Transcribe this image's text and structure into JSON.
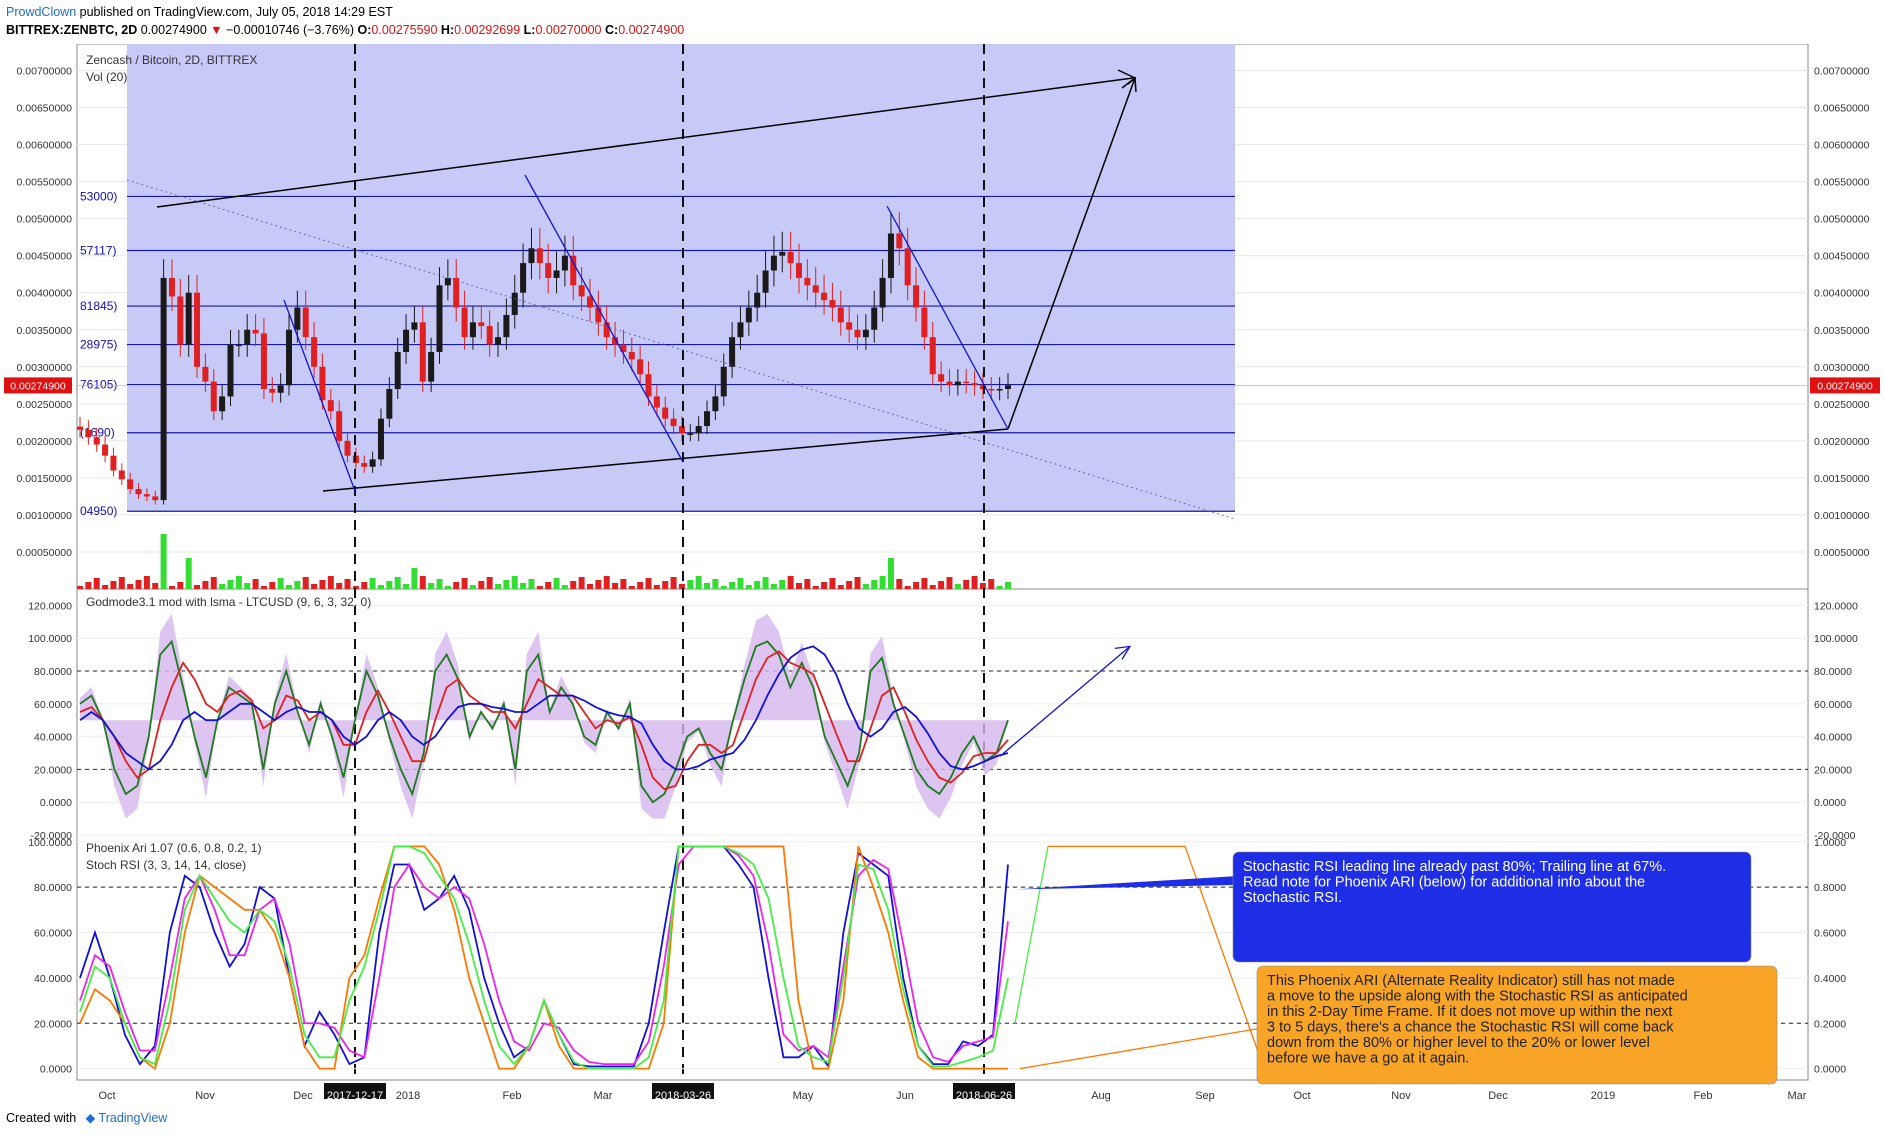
{
  "header": {
    "author": "ProwdClown",
    "published": "published on TradingView.com, July 05, 2018 14:29 EST",
    "symbol": "BITTREX:ZENBTC, 2D",
    "last": "0.00274900",
    "arrow": "▼",
    "change": "−0.00010746 (−3.76%)",
    "ohlc": [
      {
        "k": "O:",
        "v": "0.00275590"
      },
      {
        "k": "H:",
        "v": "0.00292699"
      },
      {
        "k": "L:",
        "v": "0.00270000"
      },
      {
        "k": "C:",
        "v": "0.00274900"
      }
    ]
  },
  "footer": {
    "created": "Created with",
    "brand": "TradingView"
  },
  "colors": {
    "fib_zone": "#c4c6f6",
    "up": "#1a1a1a",
    "down": "#e02020",
    "vol_up": "#33dd33",
    "vol_down": "#e02020",
    "green": "#1e7a1e",
    "red": "#e02020",
    "blue": "#1010dd",
    "magenta": "#ee22ee",
    "orange": "#ff7700",
    "lightgreen": "#44ee44",
    "purple_fill": "#d6b6ee",
    "note_blue": "#1e2ee6",
    "note_orange": "#f7a427"
  },
  "chart_data": [
    {
      "type": "candlestick",
      "title": "Zencash / Bitcoin, 2D, BITTREX",
      "subtitle": "Vol (20)",
      "y_ticks": [
        "0.00700000",
        "0.00650000",
        "0.00600000",
        "0.00550000",
        "0.00500000",
        "0.00450000",
        "0.00400000",
        "0.00350000",
        "0.00300000",
        "0.00250000",
        "0.00200000",
        "0.00150000",
        "0.00100000",
        "0.00050000"
      ],
      "ylim": [
        0.0,
        0.00725
      ],
      "last_price_label": "0.00274900",
      "fib_levels": [
        {
          "label": "53000)",
          "value": 0.0053
        },
        {
          "label": "57117)",
          "value": 0.00457
        },
        {
          "label": "81845)",
          "value": 0.00382
        },
        {
          "label": "28975)",
          "value": 0.0033
        },
        {
          "label": "76105)",
          "value": 0.00276
        },
        {
          "label": "(1690)",
          "value": 0.00211
        },
        {
          "label": "04950)",
          "value": 0.00105
        }
      ],
      "close_series": [
        0.00215,
        0.00205,
        0.00195,
        0.0018,
        0.0016,
        0.00148,
        0.00135,
        0.00128,
        0.00125,
        0.0012,
        0.0042,
        0.00395,
        0.0033,
        0.004,
        0.003,
        0.0028,
        0.0024,
        0.0026,
        0.0033,
        0.0033,
        0.0035,
        0.00345,
        0.0027,
        0.00265,
        0.00275,
        0.0035,
        0.0038,
        0.0034,
        0.003,
        0.00255,
        0.0024,
        0.002,
        0.0018,
        0.0017,
        0.00165,
        0.00175,
        0.0023,
        0.0027,
        0.0032,
        0.0035,
        0.0036,
        0.0028,
        0.0032,
        0.0041,
        0.0042,
        0.0038,
        0.0034,
        0.0036,
        0.00355,
        0.0033,
        0.0034,
        0.0037,
        0.004,
        0.0044,
        0.0046,
        0.0044,
        0.0042,
        0.0043,
        0.0045,
        0.0041,
        0.00395,
        0.0038,
        0.0036,
        0.0034,
        0.0033,
        0.0032,
        0.0031,
        0.0029,
        0.0026,
        0.00245,
        0.0023,
        0.0022,
        0.0021,
        0.0021,
        0.0022,
        0.0024,
        0.0026,
        0.003,
        0.0034,
        0.0036,
        0.0038,
        0.004,
        0.0043,
        0.0045,
        0.00455,
        0.0044,
        0.0042,
        0.0041,
        0.004,
        0.0039,
        0.0038,
        0.0036,
        0.0035,
        0.0034,
        0.0035,
        0.0038,
        0.0042,
        0.0048,
        0.0046,
        0.0041,
        0.0038,
        0.0034,
        0.0029,
        0.0028,
        0.00275,
        0.0028,
        0.00278,
        0.00275,
        0.0027,
        0.00268,
        0.0027,
        0.00275
      ],
      "x_ticks": [
        {
          "label": "Oct",
          "x": 0
        },
        {
          "label": "Nov",
          "x": 1
        },
        {
          "label": "Dec",
          "x": 2
        },
        {
          "label": "2017-12-17",
          "x": 2.5,
          "highlight": true
        },
        {
          "label": "2018",
          "x": 3
        },
        {
          "label": "Feb",
          "x": 4
        },
        {
          "label": "Mar",
          "x": 5
        },
        {
          "label": "2018-03-26",
          "x": 5.8,
          "highlight": true
        },
        {
          "label": "May",
          "x": 7
        },
        {
          "label": "Jun",
          "x": 8
        },
        {
          "label": "2018-06-26",
          "x": 8.8,
          "highlight": true
        },
        {
          "label": "Aug",
          "x": 10
        },
        {
          "label": "Sep",
          "x": 11
        },
        {
          "label": "Oct",
          "x": 12
        },
        {
          "label": "Nov",
          "x": 13
        },
        {
          "label": "Dec",
          "x": 14
        },
        {
          "label": "2019",
          "x": 15
        },
        {
          "label": "Feb",
          "x": 16
        },
        {
          "label": "Mar",
          "x": 17
        }
      ]
    },
    {
      "type": "line",
      "title": "Godmode3.1 mod with lsma - LTCUSD (9, 6, 3, 32, 0)",
      "y_ticks": [
        "120.0000",
        "100.0000",
        "80.0000",
        "60.0000",
        "40.0000",
        "20.0000",
        "0.0000",
        "-20.0000"
      ],
      "ylim": [
        -20,
        130
      ],
      "series": [
        {
          "color": "green",
          "values": [
            60,
            65,
            50,
            20,
            5,
            10,
            40,
            90,
            98,
            70,
            40,
            15,
            50,
            70,
            65,
            60,
            20,
            60,
            80,
            55,
            35,
            60,
            40,
            15,
            50,
            80,
            65,
            40,
            20,
            5,
            30,
            80,
            90,
            75,
            40,
            55,
            45,
            60,
            20,
            80,
            90,
            55,
            70,
            60,
            40,
            35,
            55,
            45,
            60,
            10,
            0,
            5,
            20,
            40,
            45,
            30,
            20,
            50,
            75,
            95,
            98,
            90,
            70,
            85,
            70,
            40,
            25,
            10,
            30,
            80,
            88,
            60,
            40,
            20,
            10,
            5,
            15,
            30,
            40,
            25,
            30,
            50
          ]
        },
        {
          "color": "red",
          "values": [
            55,
            58,
            50,
            40,
            25,
            15,
            20,
            50,
            70,
            85,
            75,
            60,
            55,
            65,
            68,
            62,
            45,
            50,
            65,
            62,
            50,
            55,
            50,
            35,
            35,
            55,
            68,
            55,
            40,
            25,
            25,
            50,
            70,
            75,
            65,
            60,
            55,
            55,
            45,
            60,
            75,
            70,
            65,
            65,
            55,
            45,
            50,
            48,
            52,
            35,
            15,
            8,
            10,
            25,
            35,
            35,
            30,
            35,
            55,
            75,
            88,
            92,
            85,
            82,
            78,
            60,
            42,
            25,
            25,
            45,
            65,
            70,
            55,
            38,
            25,
            15,
            12,
            18,
            28,
            30,
            30,
            38
          ]
        },
        {
          "color": "blue",
          "values": [
            50,
            55,
            50,
            40,
            30,
            25,
            20,
            25,
            35,
            50,
            55,
            50,
            50,
            55,
            60,
            60,
            55,
            50,
            55,
            58,
            55,
            55,
            50,
            40,
            35,
            40,
            50,
            55,
            50,
            40,
            35,
            40,
            50,
            58,
            60,
            60,
            58,
            57,
            55,
            55,
            60,
            65,
            65,
            65,
            62,
            58,
            55,
            53,
            52,
            48,
            35,
            25,
            20,
            20,
            22,
            26,
            28,
            30,
            38,
            50,
            65,
            78,
            88,
            93,
            95,
            90,
            78,
            60,
            45,
            40,
            45,
            55,
            58,
            52,
            42,
            30,
            22,
            20,
            22,
            25,
            28,
            30
          ]
        }
      ]
    },
    {
      "type": "line",
      "title": "Phoenix Ari 1.07 (0.6, 0.8, 0.2, 1)",
      "subtitle": "Stoch RSI (3, 3, 14, 14, close)",
      "y_ticks_left": [
        "100.0000",
        "80.0000",
        "60.0000",
        "40.0000",
        "20.0000",
        "0.0000"
      ],
      "y_ticks_right": [
        "1.0000",
        "0.8000",
        "0.6000",
        "0.4000",
        "0.2000",
        "0.0000"
      ],
      "ylim": [
        -5,
        103
      ],
      "series": [
        {
          "color": "blue",
          "values": [
            40,
            60,
            40,
            15,
            2,
            10,
            60,
            85,
            80,
            60,
            45,
            55,
            80,
            75,
            40,
            10,
            25,
            15,
            2,
            5,
            60,
            90,
            90,
            70,
            75,
            85,
            70,
            40,
            20,
            5,
            10,
            30,
            15,
            2,
            1,
            1,
            1,
            1,
            20,
            60,
            98,
            98,
            98,
            98,
            90,
            80,
            40,
            5,
            5,
            10,
            1,
            60,
            95,
            90,
            85,
            40,
            10,
            2,
            2,
            12,
            10,
            15,
            90
          ]
        },
        {
          "color": "magenta",
          "values": [
            30,
            50,
            45,
            25,
            8,
            8,
            40,
            75,
            85,
            70,
            50,
            50,
            70,
            75,
            55,
            20,
            20,
            18,
            8,
            5,
            40,
            80,
            90,
            80,
            75,
            80,
            75,
            55,
            30,
            12,
            8,
            20,
            18,
            8,
            3,
            2,
            2,
            2,
            12,
            45,
            90,
            98,
            98,
            98,
            94,
            85,
            55,
            15,
            8,
            10,
            5,
            45,
            85,
            92,
            88,
            55,
            20,
            5,
            3,
            10,
            12,
            14,
            65
          ]
        },
        {
          "color": "orange",
          "values": [
            20,
            35,
            30,
            20,
            5,
            0,
            20,
            60,
            85,
            80,
            75,
            70,
            70,
            60,
            40,
            10,
            0,
            0,
            40,
            50,
            75,
            98,
            98,
            98,
            90,
            70,
            40,
            20,
            0,
            0,
            10,
            30,
            10,
            0,
            0,
            0,
            0,
            0,
            0,
            20,
            98,
            98,
            98,
            98,
            98,
            98,
            98,
            98,
            30,
            0,
            0,
            30,
            98,
            80,
            60,
            30,
            5,
            0,
            0,
            0,
            0,
            0,
            0
          ]
        },
        {
          "color": "lightgreen",
          "values": [
            25,
            45,
            40,
            20,
            5,
            2,
            30,
            70,
            85,
            75,
            65,
            60,
            70,
            65,
            45,
            15,
            5,
            5,
            30,
            45,
            70,
            98,
            98,
            95,
            85,
            75,
            55,
            30,
            10,
            2,
            10,
            30,
            15,
            3,
            0,
            0,
            0,
            0,
            5,
            30,
            98,
            98,
            98,
            98,
            95,
            90,
            75,
            40,
            10,
            5,
            3,
            40,
            90,
            88,
            70,
            35,
            10,
            1,
            1,
            3,
            5,
            8,
            40
          ]
        }
      ],
      "annotations": [
        {
          "text_lines": [
            "Stochastic RSI leading line already past 80%; Trailing line at 67%.",
            "Read note for Phoenix ARI (below) for additional info about the",
            "Stochastic RSI."
          ]
        },
        {
          "text_lines": [
            "This Phoenix ARI (Alternate Reality Indicator) still has not made",
            "a move to the upside along with the Stochastic RSI as anticipated",
            "in this 2-Day Time Frame.  If it does not move up within the next",
            "3 to 5 days, there's a chance the Stochastic RSI will come back",
            "down from the 80% or higher level to the 20% or lower level",
            "before we have a go at it again."
          ]
        }
      ]
    }
  ]
}
